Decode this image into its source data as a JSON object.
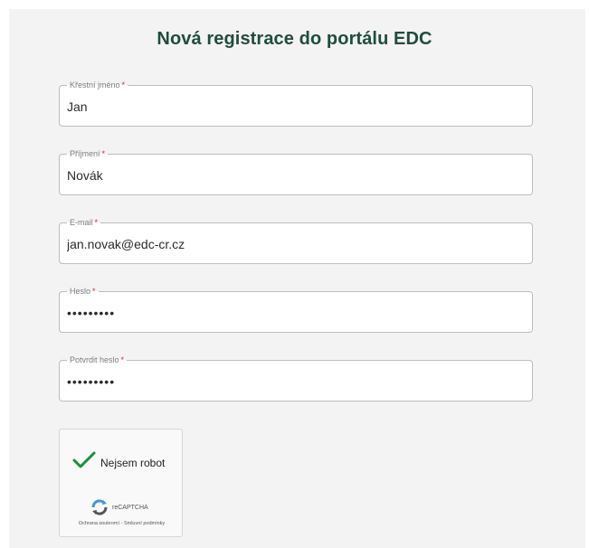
{
  "form": {
    "title": "Nová registrace do portálu EDC",
    "required_mark": "*",
    "fields": {
      "first_name": {
        "label": "Křestní jméno",
        "value": "Jan"
      },
      "last_name": {
        "label": "Příjmení",
        "value": "Novák"
      },
      "email": {
        "label": "E-mail",
        "value": "jan.novak@edc-cr.cz"
      },
      "password": {
        "label": "Heslo",
        "value": "•••••••••"
      },
      "confirm_password": {
        "label": "Potvrdit heslo",
        "value": "•••••••••"
      }
    }
  },
  "captcha": {
    "label": "Nejsem robot",
    "checked": true,
    "brand": "reCAPTCHA",
    "privacy_link": "Ochrana soukromí",
    "separator": " - ",
    "terms_link": "Smluvní podmínky",
    "check_color": "#1e8e3e"
  },
  "colors": {
    "title": "#1f4d3d",
    "required": "#d32f2f",
    "background": "#f3f3f3"
  }
}
